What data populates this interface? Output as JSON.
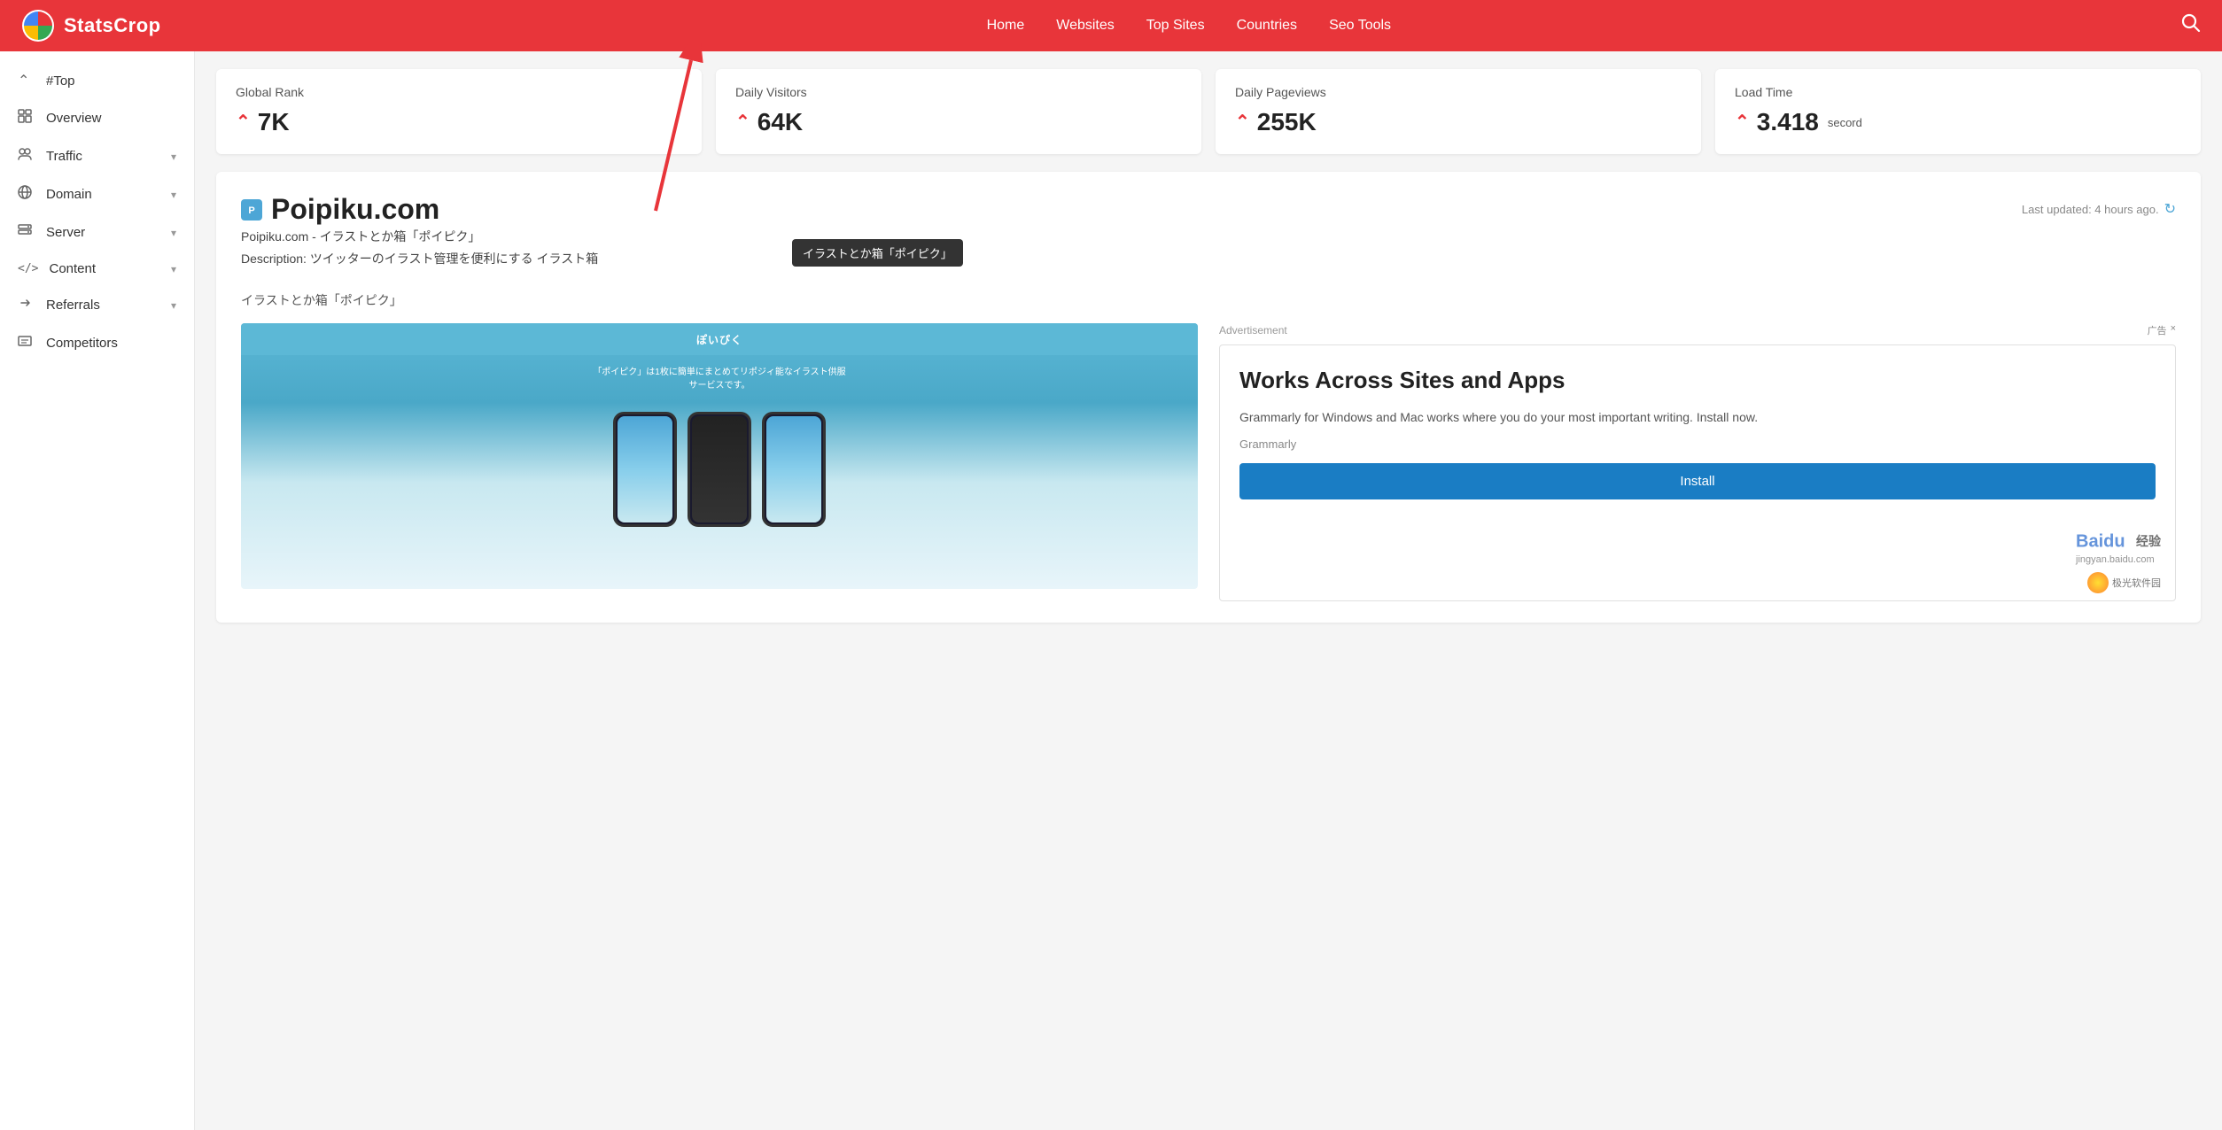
{
  "navbar": {
    "brand": "StatsCrop",
    "nav_items": [
      {
        "label": "Home",
        "id": "home"
      },
      {
        "label": "Websites",
        "id": "websites"
      },
      {
        "label": "Top Sites",
        "id": "top-sites"
      },
      {
        "label": "Countries",
        "id": "countries"
      },
      {
        "label": "Seo Tools",
        "id": "seo-tools"
      }
    ]
  },
  "sidebar": {
    "items": [
      {
        "label": "#Top",
        "icon": "⌃",
        "has_chevron": false,
        "id": "top"
      },
      {
        "label": "Overview",
        "icon": "🖥",
        "has_chevron": false,
        "id": "overview"
      },
      {
        "label": "Traffic",
        "icon": "👥",
        "has_chevron": true,
        "id": "traffic"
      },
      {
        "label": "Domain",
        "icon": "🌐",
        "has_chevron": true,
        "id": "domain"
      },
      {
        "label": "Server",
        "icon": "☰",
        "has_chevron": true,
        "id": "server"
      },
      {
        "label": "Content",
        "icon": "</>",
        "has_chevron": true,
        "id": "content"
      },
      {
        "label": "Referrals",
        "icon": "🔗",
        "has_chevron": true,
        "id": "referrals"
      },
      {
        "label": "Competitors",
        "icon": "📋",
        "has_chevron": false,
        "id": "competitors"
      }
    ]
  },
  "stats": [
    {
      "label": "Global Rank",
      "value": "7K",
      "has_arrow": true
    },
    {
      "label": "Daily Visitors",
      "value": "64K",
      "has_arrow": true
    },
    {
      "label": "Daily Pageviews",
      "value": "255K",
      "has_arrow": true
    },
    {
      "label": "Load Time",
      "value": "3.418",
      "unit": "secord",
      "has_arrow": true
    }
  ],
  "site": {
    "name": "Poipiku.com",
    "favicon_text": "P",
    "description_line1": "Poipiku.com - イラストとか箱「ポイピク」",
    "description_line2": "Description: ツイッターのイラスト管理を便利にする イラスト箱",
    "section_title": "イラストとか箱「ポイピク」",
    "last_updated": "Last updated: 4 hours ago.",
    "tooltip": "イラストとか箱「ポイピク」"
  },
  "advertisement": {
    "label": "Advertisement",
    "headline": "Works Across Sites and Apps",
    "body": "Grammarly for Windows and Mac works where you do your most important writing. Install now.",
    "brand": "Grammarly",
    "button_label": "Install",
    "ad_controls": [
      "广告",
      "×"
    ]
  },
  "watermarks": {
    "baidu_text": "Baidu 经验",
    "baidu_sub": "jingyan.baidu.com",
    "aurora_text": "极光软件园"
  }
}
